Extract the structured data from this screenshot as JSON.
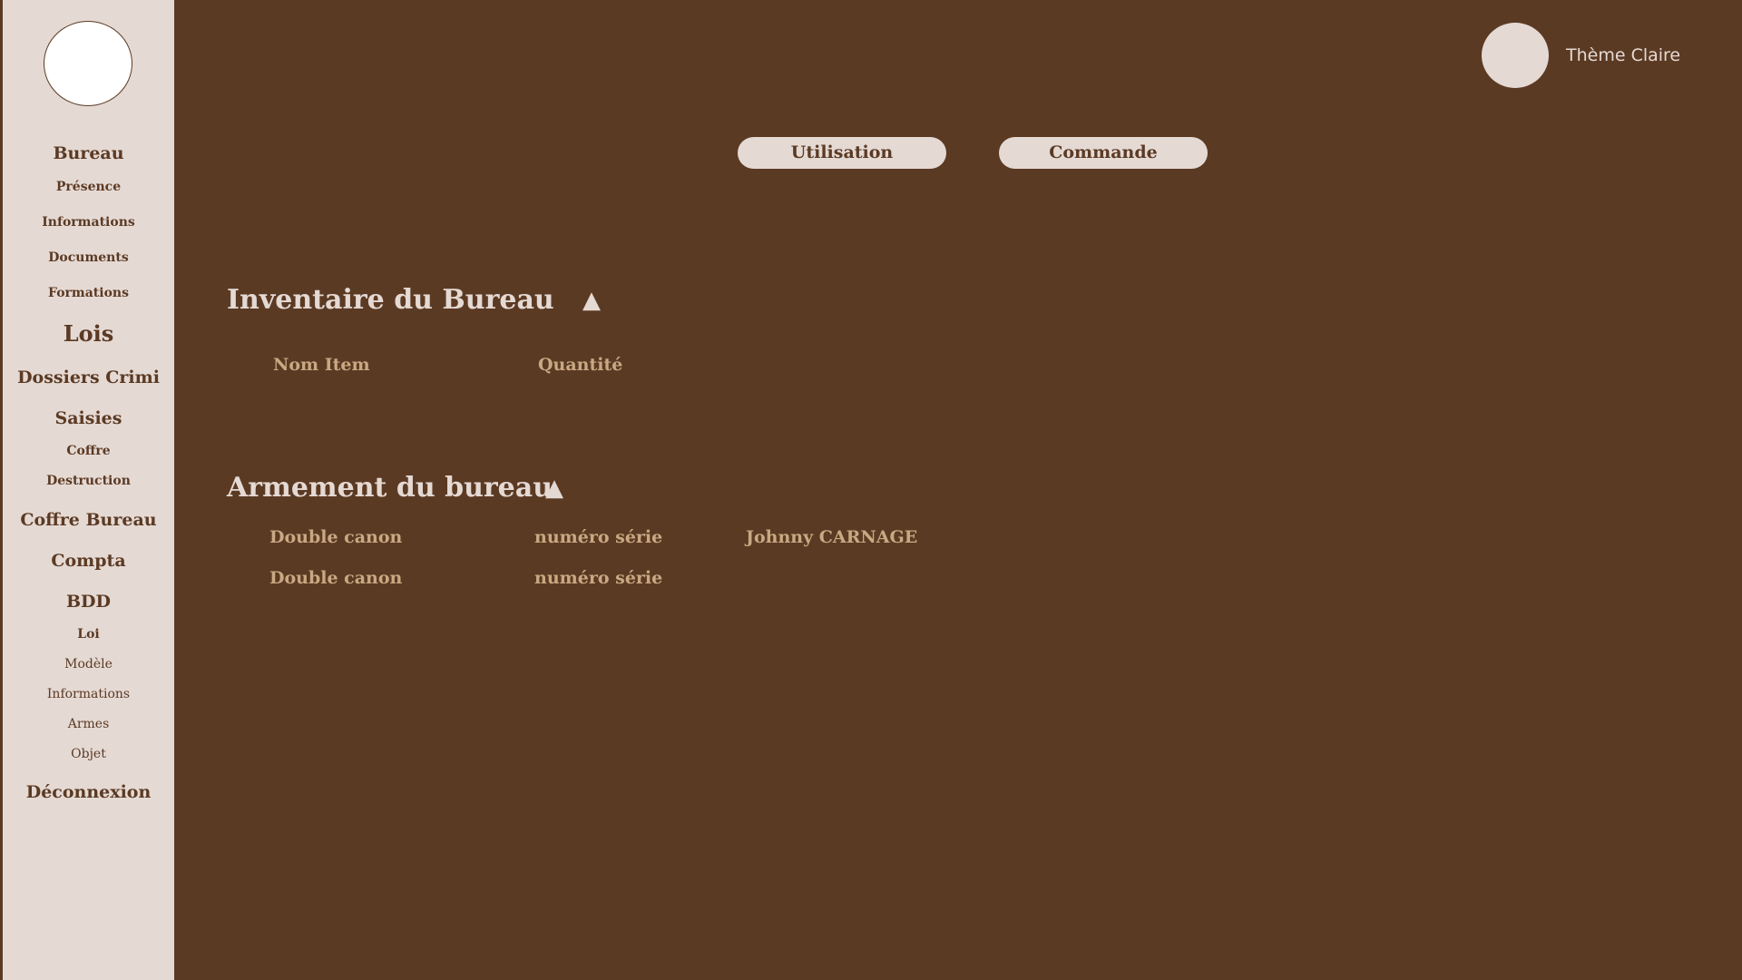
{
  "sidebar": {
    "items": [
      {
        "label": "Bureau"
      },
      {
        "label": "Présence"
      },
      {
        "label": "Informations"
      },
      {
        "label": "Documents"
      },
      {
        "label": "Formations"
      },
      {
        "label": "Lois"
      },
      {
        "label": "Dossiers Crimi"
      },
      {
        "label": "Saisies"
      },
      {
        "label": "Coffre"
      },
      {
        "label": "Destruction"
      },
      {
        "label": "Coffre Bureau"
      },
      {
        "label": "Compta"
      },
      {
        "label": "BDD"
      },
      {
        "label": "Loi"
      },
      {
        "label": "Modèle"
      },
      {
        "label": "Informations"
      },
      {
        "label": "Armes"
      },
      {
        "label": "Objet"
      },
      {
        "label": "Déconnexion"
      }
    ]
  },
  "header": {
    "theme_label": "Thème Claire"
  },
  "tabs": [
    {
      "label": "Utilisation"
    },
    {
      "label": "Commande"
    }
  ],
  "inventory": {
    "title": "Inventaire du Bureau",
    "toggle": "▲",
    "columns": [
      "Nom Item",
      "Quantité"
    ]
  },
  "armament": {
    "title": "Armement du bureau",
    "toggle": "▲",
    "rows": [
      [
        "Double canon",
        "numéro série",
        "Johnny CARNAGE"
      ],
      [
        "Double canon",
        "numéro série",
        ""
      ]
    ]
  },
  "colors": {
    "background": "#5b3a24",
    "sidebar": "#e5d9d3",
    "accent_text": "#c9a882"
  }
}
